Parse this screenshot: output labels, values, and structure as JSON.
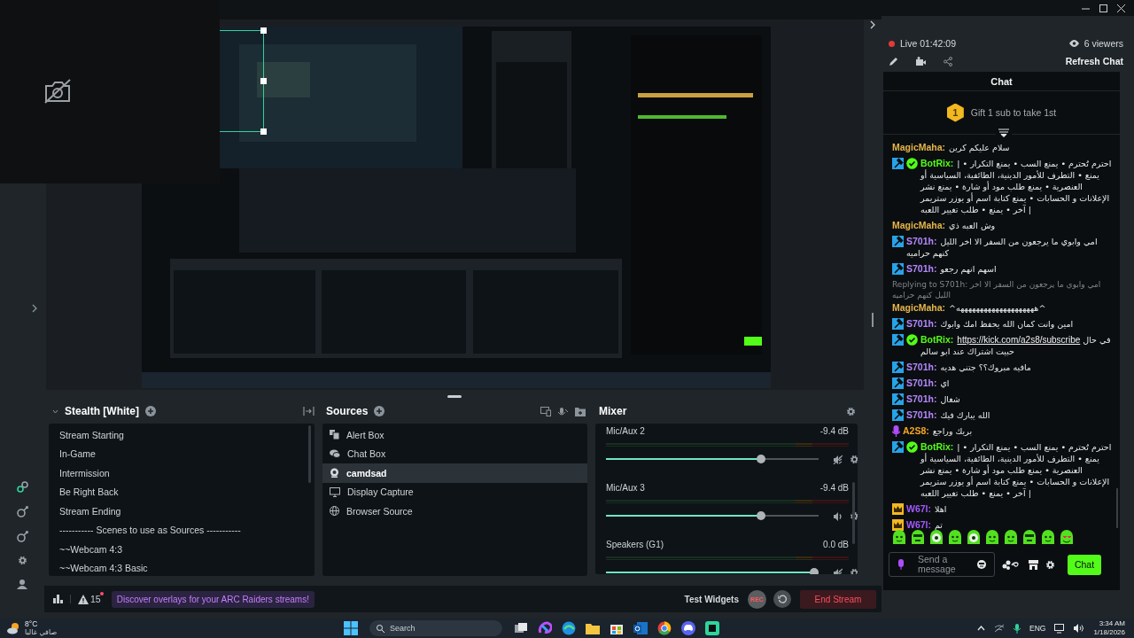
{
  "scenes": {
    "title": "Stealth [White]",
    "expanded": true,
    "items": [
      {
        "label": "Stream Starting"
      },
      {
        "label": "In-Game"
      },
      {
        "label": "Intermission"
      },
      {
        "label": "Be Right Back"
      },
      {
        "label": "Stream Ending"
      },
      {
        "label": "----------- Scenes to use as Sources -----------"
      },
      {
        "label": "~~Webcam 4:3"
      },
      {
        "label": "~~Webcam 4:3 Basic"
      }
    ]
  },
  "sources": {
    "title": "Sources",
    "items": [
      {
        "label": "Alert Box",
        "kind": "alert",
        "selected": false
      },
      {
        "label": "Chat Box",
        "kind": "chat",
        "selected": false
      },
      {
        "label": "camdsad",
        "kind": "webcam",
        "selected": true
      },
      {
        "label": "Display Capture",
        "kind": "display",
        "selected": false
      },
      {
        "label": "Browser Source",
        "kind": "browser",
        "selected": false
      }
    ]
  },
  "mixer": {
    "title": "Mixer",
    "channels": [
      {
        "name": "Mic/Aux 2",
        "reading": "-9.4 dB",
        "level": 0.74,
        "muted": true
      },
      {
        "name": "Mic/Aux 3",
        "reading": "-9.4 dB",
        "level": 0.74,
        "muted": false
      },
      {
        "name": "Speakers (G1)",
        "reading": "0.0 dB",
        "level": 1.0,
        "muted": true
      }
    ]
  },
  "footer": {
    "alerts": "15",
    "banner": "Discover overlays for your ARC Raiders streams!",
    "test_widgets": "Test Widgets",
    "rec": "REC",
    "end_stream": "End Stream"
  },
  "chat": {
    "live": "Live 01:42:09",
    "viewers": "6 viewers",
    "refresh": "Refresh Chat",
    "title": "Chat",
    "gift_rank": "1",
    "gift": "Gift 1 sub to take 1st",
    "messages": [
      {
        "kind": "message",
        "user": "MagicMaha:",
        "color": "#e5b54a",
        "text": "سلام عليكم كرين"
      },
      {
        "kind": "message",
        "user": "BotRix:",
        "color": "#53fc18",
        "badges": [
          {
            "kind": "mod"
          },
          {
            "kind": "verified"
          }
        ],
        "text": "| احترم تُحترم • يمنع السب • يمنع التكرار • يمنع • التطرف للأمور الدينية، الطائفية، السياسية أو العنصرية • يمنع طلب مود أو شارة • يمنع نشر الإعلانات و الحسابات • يمنع كتابة اسم أو يوزر ستريمر آخر • يمنع • طلب تغيير اللعبه |"
      },
      {
        "kind": "message",
        "user": "MagicMaha:",
        "color": "#e5b54a",
        "text": "وش العبه ذي"
      },
      {
        "kind": "message",
        "user": "S701h:",
        "color": "#b388ff",
        "badges": [
          {
            "kind": "mod"
          }
        ],
        "text": "امي وابوي ما يرجعون من السفر الا اخر الليل كنهم حراميه"
      },
      {
        "kind": "message",
        "user": "S701h:",
        "color": "#b388ff",
        "badges": [
          {
            "kind": "mod"
          }
        ],
        "text": "اسهم انهم رجعو"
      },
      {
        "kind": "reply",
        "text": "Replying to S701h: امي وابوي ما يرجعون من السفر الا اخر الليل كنهم حراميه"
      },
      {
        "kind": "message",
        "user": "MagicMaha:",
        "color": "#e5b54a",
        "text": "^ههههههههههههههههههههه^"
      },
      {
        "kind": "message",
        "user": "S701h:",
        "color": "#b388ff",
        "badges": [
          {
            "kind": "mod"
          }
        ],
        "text": "امين وانت كمان الله يحفظ امك وابوك"
      },
      {
        "kind": "message",
        "user": "BotRix:",
        "color": "#53fc18",
        "badges": [
          {
            "kind": "mod"
          },
          {
            "kind": "verified"
          }
        ],
        "link": "https://kick.com/a2s8/subscribe",
        "text": "في حال حبيت اشتراك عند ابو سالم"
      },
      {
        "kind": "message",
        "user": "S701h:",
        "color": "#b388ff",
        "badges": [
          {
            "kind": "mod"
          }
        ],
        "text": "مافيه مبروك؟؟ جتني هديه"
      },
      {
        "kind": "message",
        "user": "S701h:",
        "color": "#b388ff",
        "badges": [
          {
            "kind": "mod"
          }
        ],
        "text": "اي"
      },
      {
        "kind": "message",
        "user": "S701h:",
        "color": "#b388ff",
        "badges": [
          {
            "kind": "mod"
          }
        ],
        "text": "شغال"
      },
      {
        "kind": "message",
        "user": "S701h:",
        "color": "#b388ff",
        "badges": [
          {
            "kind": "mod"
          }
        ],
        "text": "الله يبارك فيك"
      },
      {
        "kind": "message",
        "user": "A2S8:",
        "color": "#f5a623",
        "badges": [
          {
            "kind": "mic"
          }
        ],
        "text": "بريك وراجع"
      },
      {
        "kind": "message",
        "user": "BotRix:",
        "color": "#53fc18",
        "badges": [
          {
            "kind": "mod"
          },
          {
            "kind": "verified"
          }
        ],
        "text": "| احترم تُحترم • يمنع السب • يمنع التكرار • يمنع • التطرف للأمور الدينية، الطائفية، السياسية أو العنصرية • يمنع طلب مود أو شارة • يمنع نشر الإعلانات و الحسابات • يمنع كتابة اسم أو يوزر ستريمر آخر • يمنع • طلب تغيير اللعبه |"
      },
      {
        "kind": "message",
        "user": "W67l:",
        "color": "#a259ff",
        "badges": [
          {
            "kind": "crown"
          }
        ],
        "text": "اهلا"
      },
      {
        "kind": "message",
        "user": "W67l:",
        "color": "#a259ff",
        "badges": [
          {
            "kind": "crown"
          }
        ],
        "text": "تم"
      }
    ],
    "input_placeholder": "Send a message",
    "send": "Chat"
  },
  "taskbar": {
    "temperature": "8°C",
    "weather": "صافي غالبا",
    "search_placeholder": "Search",
    "language": "ENG",
    "time": "3:34 AM",
    "date": "1/18/2026"
  }
}
